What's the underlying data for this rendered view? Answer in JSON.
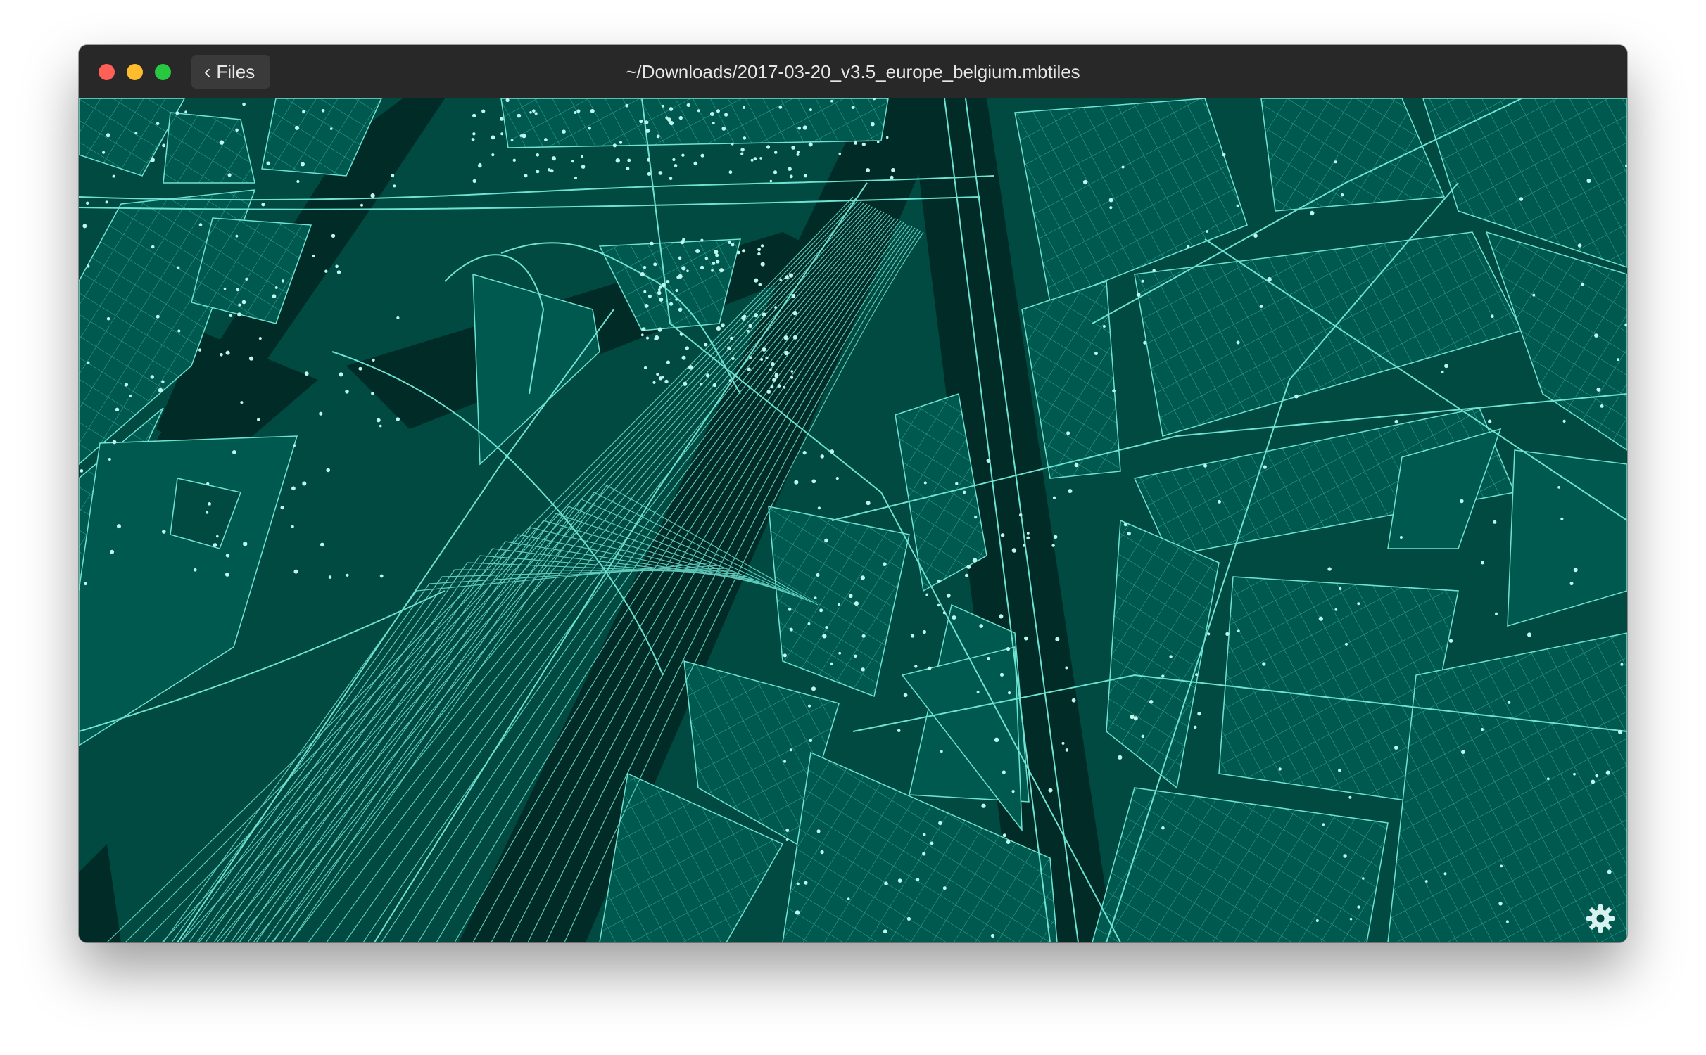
{
  "window": {
    "title": "~/Downloads/2017-03-20_v3.5_europe_belgium.mbtiles",
    "back_button_label": "Files",
    "back_icon": "chevron-left-icon",
    "traffic_lights": {
      "close": "#ff5f57",
      "minimize": "#febc2e",
      "maximize": "#28c840"
    }
  },
  "map": {
    "style": {
      "background": "#014a42",
      "building_fill": "#00594f",
      "dark_area": "#012b26",
      "line": "#6fe3d3",
      "point": "#bff5ec"
    },
    "settings_icon": "gear-icon"
  }
}
